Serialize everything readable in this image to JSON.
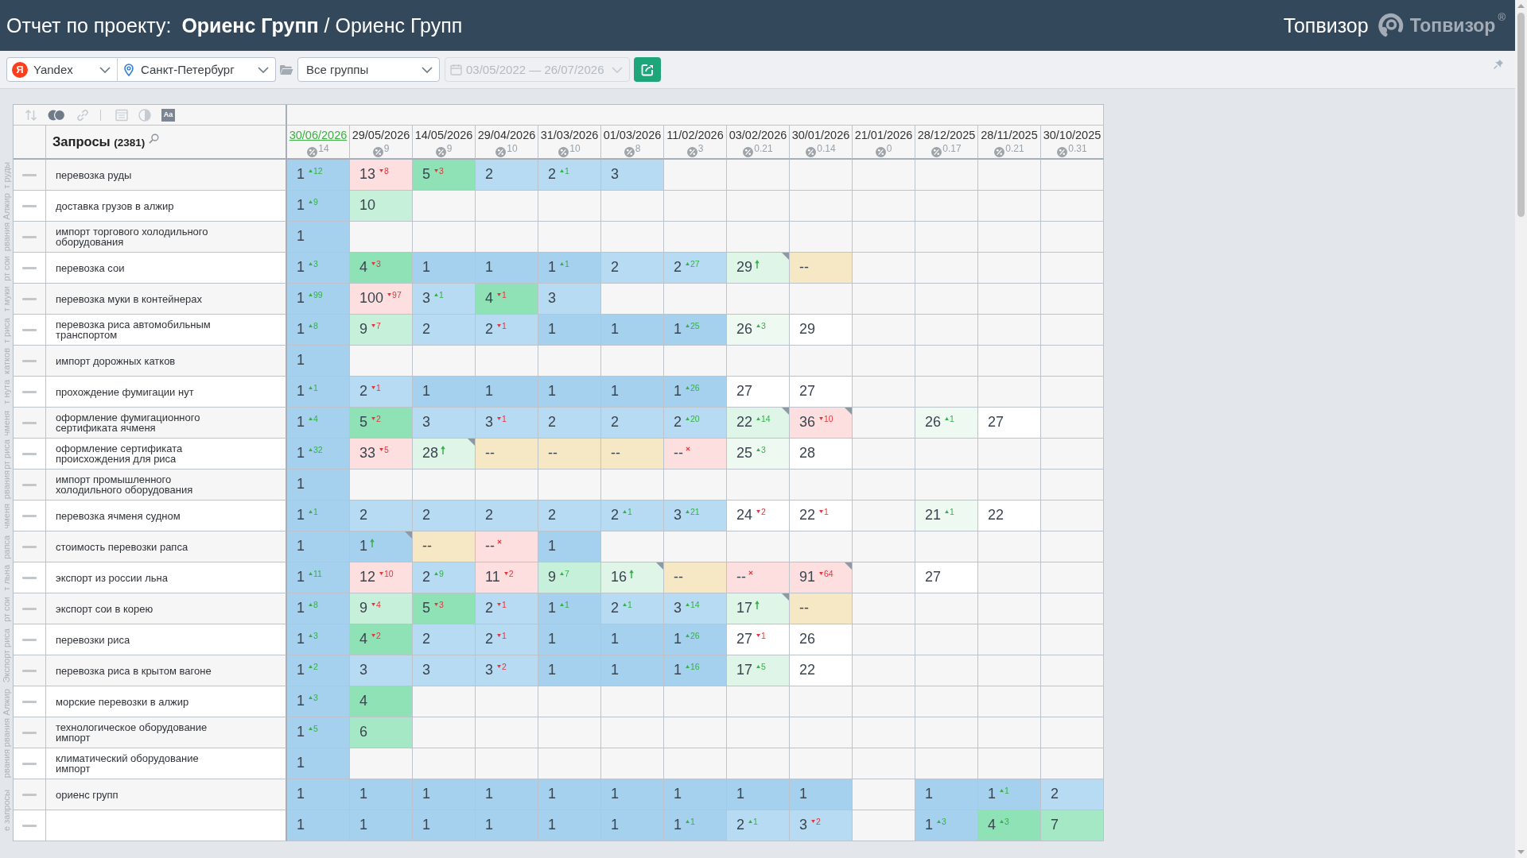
{
  "header": {
    "title": "Отчет по проекту: **Ориенс Групп** / Ориенс Групп",
    "account": "Топвизор",
    "brand": "Топвизор$^{®}$"
  },
  "filters": {
    "engine": {
      "logo": "Я",
      "value": "Yandex"
    },
    "region": {
      "value": "Санкт-Петербург"
    },
    "group": {
      "value": "Все группы"
    },
    "dates": {
      "value": "03/05/2022 — 26/07/2026",
      "disabled": true
    }
  },
  "table": {
    "tools": [
      {
        "kind": "sort",
        "disabled": true
      },
      {
        "kind": "toggle",
        "disabled": false
      },
      {
        "kind": "link",
        "disabled": true
      },
      {
        "kind": "divider"
      },
      {
        "kind": "panel",
        "disabled": true
      },
      {
        "kind": "contrast",
        "disabled": true
      },
      {
        "kind": "font",
        "label": "Aa",
        "disabled": false
      }
    ],
    "queries_title": "Запросы",
    "queries_count": "(2381)",
    "columns": [
      {
        "date": "30/06/2026",
        "selected": true,
        "share": "14"
      },
      {
        "date": "29/05/2026",
        "selected": false,
        "share": "9"
      },
      {
        "date": "14/05/2026",
        "selected": false,
        "share": "9"
      },
      {
        "date": "29/04/2026",
        "selected": false,
        "share": "10"
      },
      {
        "date": "31/03/2026",
        "selected": false,
        "share": "10"
      },
      {
        "date": "01/03/2026",
        "selected": false,
        "share": "8"
      },
      {
        "date": "11/02/2026",
        "selected": false,
        "share": "3"
      },
      {
        "date": "03/02/2026",
        "selected": false,
        "share": "0.21"
      },
      {
        "date": "30/01/2026",
        "selected": false,
        "share": "0.14"
      },
      {
        "date": "21/01/2026",
        "selected": false,
        "share": "0"
      },
      {
        "date": "28/12/2025",
        "selected": false,
        "share": "0.17"
      },
      {
        "date": "28/11/2025",
        "selected": false,
        "share": "0.21"
      },
      {
        "date": "30/10/2025",
        "selected": false,
        "share": "0.31"
      }
    ],
    "rows": [
      {
        "side_label": "т руды",
        "query": "перевозка руды",
        "cells": [
          {
            "value": "1",
            "kind": "up",
            "change": "12",
            "flag": false,
            "color": "#a5d1ef"
          },
          {
            "value": "13",
            "kind": "down",
            "change": "8",
            "flag": false,
            "color": "#fddfe0"
          },
          {
            "value": "5",
            "kind": "down",
            "change": "3",
            "flag": false,
            "color": "#8fe1b6"
          },
          {
            "value": "2",
            "kind": "plain",
            "flag": false,
            "color": "#b7dbf2"
          },
          {
            "value": "2",
            "kind": "up",
            "change": "1",
            "flag": false,
            "color": "#b7dbf2"
          },
          {
            "value": "3",
            "kind": "plain",
            "flag": false,
            "color": "#b7dbf2"
          },
          null,
          null,
          null,
          null,
          null,
          null,
          null
        ]
      },
      {
        "side_label": "Алжир",
        "query": "доставка грузов в алжир",
        "cells": [
          {
            "value": "1",
            "kind": "up",
            "change": "9",
            "flag": false,
            "color": "#a5d1ef"
          },
          {
            "value": "10",
            "kind": "plain",
            "flag": false,
            "color": "#c7f0da"
          },
          null,
          null,
          null,
          null,
          null,
          null,
          null,
          null,
          null,
          null,
          null
        ]
      },
      {
        "side_label": "рвания",
        "query": "импорт торгового холодильного оборудования",
        "cells": [
          {
            "value": "1",
            "kind": "plain",
            "flag": false,
            "color": "#a5d1ef"
          },
          null,
          null,
          null,
          null,
          null,
          null,
          null,
          null,
          null,
          null,
          null,
          null
        ]
      },
      {
        "side_label": "рт сои",
        "query": "перевозка сои",
        "cells": [
          {
            "value": "1",
            "kind": "up",
            "change": "3",
            "flag": false,
            "color": "#a5d1ef"
          },
          {
            "value": "4",
            "kind": "down",
            "change": "3",
            "flag": false,
            "color": "#8fe1b6"
          },
          {
            "value": "1",
            "kind": "plain",
            "flag": false,
            "color": "#a5d1ef"
          },
          {
            "value": "1",
            "kind": "plain",
            "flag": false,
            "color": "#a5d1ef"
          },
          {
            "value": "1",
            "kind": "up",
            "change": "1",
            "flag": false,
            "color": "#a5d1ef"
          },
          {
            "value": "2",
            "kind": "plain",
            "flag": false,
            "color": "#b7dbf2"
          },
          {
            "value": "2",
            "kind": "up",
            "change": "27",
            "flag": false,
            "color": "#b7dbf2"
          },
          {
            "value": "29",
            "kind": "new",
            "flag": true,
            "color": "#dff5e8"
          },
          {
            "value": "--",
            "kind": "plain",
            "flag": false,
            "color": "#f6e8c5"
          },
          null,
          null,
          null,
          null
        ]
      },
      {
        "side_label": "т муки",
        "query": "перевозка муки в контейнерах",
        "cells": [
          {
            "value": "1",
            "kind": "up",
            "change": "99",
            "flag": false,
            "color": "#a5d1ef"
          },
          {
            "value": "100",
            "kind": "down",
            "change": "97",
            "flag": false,
            "color": "#fddfe0"
          },
          {
            "value": "3",
            "kind": "up",
            "change": "1",
            "flag": false,
            "color": "#b7dbf2"
          },
          {
            "value": "4",
            "kind": "down",
            "change": "1",
            "flag": false,
            "color": "#8fe1b6"
          },
          {
            "value": "3",
            "kind": "plain",
            "flag": false,
            "color": "#b7dbf2"
          },
          null,
          null,
          null,
          null,
          null,
          null,
          null,
          null
        ]
      },
      {
        "side_label": "т риса",
        "query": "перевозка риса автомобильным транспортом",
        "cells": [
          {
            "value": "1",
            "kind": "up",
            "change": "8",
            "flag": false,
            "color": "#a5d1ef"
          },
          {
            "value": "9",
            "kind": "down",
            "change": "7",
            "flag": false,
            "color": "#c7f0da"
          },
          {
            "value": "2",
            "kind": "plain",
            "flag": false,
            "color": "#b7dbf2"
          },
          {
            "value": "2",
            "kind": "down",
            "change": "1",
            "flag": false,
            "color": "#b7dbf2"
          },
          {
            "value": "1",
            "kind": "plain",
            "flag": false,
            "color": "#a5d1ef"
          },
          {
            "value": "1",
            "kind": "plain",
            "flag": false,
            "color": "#a5d1ef"
          },
          {
            "value": "1",
            "kind": "up",
            "change": "25",
            "flag": false,
            "color": "#a5d1ef"
          },
          {
            "value": "26",
            "kind": "up",
            "change": "3",
            "flag": false,
            "color": "#edf9f1"
          },
          {
            "value": "29",
            "kind": "plain",
            "flag": false,
            "color": "#ffffff"
          },
          null,
          null,
          null,
          null
        ]
      },
      {
        "side_label": "катков",
        "query": "импорт дорожных катков",
        "cells": [
          {
            "value": "1",
            "kind": "plain",
            "flag": false,
            "color": "#a5d1ef"
          },
          null,
          null,
          null,
          null,
          null,
          null,
          null,
          null,
          null,
          null,
          null,
          null
        ]
      },
      {
        "side_label": "т нута",
        "query": "прохождение фумигации нут",
        "cells": [
          {
            "value": "1",
            "kind": "up",
            "change": "1",
            "flag": false,
            "color": "#a5d1ef"
          },
          {
            "value": "2",
            "kind": "down",
            "change": "1",
            "flag": false,
            "color": "#b7dbf2"
          },
          {
            "value": "1",
            "kind": "plain",
            "flag": false,
            "color": "#a5d1ef"
          },
          {
            "value": "1",
            "kind": "plain",
            "flag": false,
            "color": "#a5d1ef"
          },
          {
            "value": "1",
            "kind": "plain",
            "flag": false,
            "color": "#a5d1ef"
          },
          {
            "value": "1",
            "kind": "plain",
            "flag": false,
            "color": "#a5d1ef"
          },
          {
            "value": "1",
            "kind": "up",
            "change": "26",
            "flag": false,
            "color": "#a5d1ef"
          },
          {
            "value": "27",
            "kind": "plain",
            "flag": false,
            "color": "#ffffff"
          },
          {
            "value": "27",
            "kind": "plain",
            "flag": false,
            "color": "#ffffff"
          },
          null,
          null,
          null,
          null
        ]
      },
      {
        "side_label": "чменя",
        "query": "оформление фумигационного сертификата ячменя",
        "cells": [
          {
            "value": "1",
            "kind": "up",
            "change": "4",
            "flag": false,
            "color": "#a5d1ef"
          },
          {
            "value": "5",
            "kind": "down",
            "change": "2",
            "flag": false,
            "color": "#8fe1b6"
          },
          {
            "value": "3",
            "kind": "plain",
            "flag": false,
            "color": "#b7dbf2"
          },
          {
            "value": "3",
            "kind": "down",
            "change": "1",
            "flag": false,
            "color": "#b7dbf2"
          },
          {
            "value": "2",
            "kind": "plain",
            "flag": false,
            "color": "#b7dbf2"
          },
          {
            "value": "2",
            "kind": "plain",
            "flag": false,
            "color": "#b7dbf2"
          },
          {
            "value": "2",
            "kind": "up",
            "change": "20",
            "flag": false,
            "color": "#b7dbf2"
          },
          {
            "value": "22",
            "kind": "up",
            "change": "14",
            "flag": true,
            "color": "#dff5e8"
          },
          {
            "value": "36",
            "kind": "down",
            "change": "10",
            "flag": true,
            "color": "#fddfe0"
          },
          null,
          {
            "value": "26",
            "kind": "up",
            "change": "1",
            "flag": false,
            "color": "#edf9f1"
          },
          {
            "value": "27",
            "kind": "plain",
            "flag": false,
            "color": "#ffffff"
          },
          null
        ]
      },
      {
        "side_label": "рт риса",
        "query": "оформление сертификата происхождения для риса",
        "cells": [
          {
            "value": "1",
            "kind": "up",
            "change": "32",
            "flag": false,
            "color": "#a5d1ef"
          },
          {
            "value": "33",
            "kind": "down",
            "change": "5",
            "flag": false,
            "color": "#fddfe0"
          },
          {
            "value": "28",
            "kind": "new",
            "flag": true,
            "color": "#dff5e8"
          },
          {
            "value": "--",
            "kind": "plain",
            "flag": false,
            "color": "#f6e8c5"
          },
          {
            "value": "--",
            "kind": "plain",
            "flag": false,
            "color": "#f6e8c5"
          },
          {
            "value": "--",
            "kind": "plain",
            "flag": false,
            "color": "#f6e8c5"
          },
          {
            "value": "--",
            "kind": "lost",
            "flag": false,
            "color": "#fddfe0"
          },
          {
            "value": "25",
            "kind": "up",
            "change": "3",
            "flag": false,
            "color": "#edf9f1"
          },
          {
            "value": "28",
            "kind": "plain",
            "flag": false,
            "color": "#ffffff"
          },
          null,
          null,
          null,
          null
        ]
      },
      {
        "side_label": "рвания",
        "query": "импорт промышленного холодильного оборудования",
        "cells": [
          {
            "value": "1",
            "kind": "plain",
            "flag": false,
            "color": "#a5d1ef"
          },
          null,
          null,
          null,
          null,
          null,
          null,
          null,
          null,
          null,
          null,
          null,
          null
        ]
      },
      {
        "side_label": "чменя",
        "query": "перевозка ячменя судном",
        "cells": [
          {
            "value": "1",
            "kind": "up",
            "change": "1",
            "flag": false,
            "color": "#a5d1ef"
          },
          {
            "value": "2",
            "kind": "plain",
            "flag": false,
            "color": "#b7dbf2"
          },
          {
            "value": "2",
            "kind": "plain",
            "flag": false,
            "color": "#b7dbf2"
          },
          {
            "value": "2",
            "kind": "plain",
            "flag": false,
            "color": "#b7dbf2"
          },
          {
            "value": "2",
            "kind": "plain",
            "flag": false,
            "color": "#b7dbf2"
          },
          {
            "value": "2",
            "kind": "up",
            "change": "1",
            "flag": false,
            "color": "#b7dbf2"
          },
          {
            "value": "3",
            "kind": "up",
            "change": "21",
            "flag": false,
            "color": "#b7dbf2"
          },
          {
            "value": "24",
            "kind": "down",
            "change": "2",
            "flag": false,
            "color": "#ffffff"
          },
          {
            "value": "22",
            "kind": "down",
            "change": "1",
            "flag": false,
            "color": "#ffffff"
          },
          null,
          {
            "value": "21",
            "kind": "up",
            "change": "1",
            "flag": false,
            "color": "#edf9f1"
          },
          {
            "value": "22",
            "kind": "plain",
            "flag": false,
            "color": "#ffffff"
          },
          null
        ]
      },
      {
        "side_label": "рапса",
        "query": "стоимость перевозки рапса",
        "cells": [
          {
            "value": "1",
            "kind": "plain",
            "flag": false,
            "color": "#a5d1ef"
          },
          {
            "value": "1",
            "kind": "new",
            "flag": true,
            "color": "#a5d1ef"
          },
          {
            "value": "--",
            "kind": "plain",
            "flag": false,
            "color": "#f6e8c5"
          },
          {
            "value": "--",
            "kind": "lost",
            "flag": false,
            "color": "#fddfe0"
          },
          {
            "value": "1",
            "kind": "plain",
            "flag": false,
            "color": "#a5d1ef"
          },
          null,
          null,
          null,
          null,
          null,
          null,
          null,
          null
        ]
      },
      {
        "side_label": "т льна",
        "query": "экспорт из россии льна",
        "cells": [
          {
            "value": "1",
            "kind": "up",
            "change": "11",
            "flag": false,
            "color": "#a5d1ef"
          },
          {
            "value": "12",
            "kind": "down",
            "change": "10",
            "flag": false,
            "color": "#fddfe0"
          },
          {
            "value": "2",
            "kind": "up",
            "change": "9",
            "flag": false,
            "color": "#b7dbf2"
          },
          {
            "value": "11",
            "kind": "down",
            "change": "2",
            "flag": false,
            "color": "#fddfe0"
          },
          {
            "value": "9",
            "kind": "up",
            "change": "7",
            "flag": false,
            "color": "#c7f0da"
          },
          {
            "value": "16",
            "kind": "new",
            "flag": true,
            "color": "#dff5e8"
          },
          {
            "value": "--",
            "kind": "plain",
            "flag": false,
            "color": "#f6e8c5"
          },
          {
            "value": "--",
            "kind": "lost",
            "flag": false,
            "color": "#fddfe0"
          },
          {
            "value": "91",
            "kind": "down",
            "change": "64",
            "flag": true,
            "color": "#fddfe0"
          },
          null,
          {
            "value": "27",
            "kind": "plain",
            "flag": false,
            "color": "#ffffff"
          },
          null,
          null
        ]
      },
      {
        "side_label": "рт сои",
        "query": "экспорт сои в корею",
        "cells": [
          {
            "value": "1",
            "kind": "up",
            "change": "8",
            "flag": false,
            "color": "#a5d1ef"
          },
          {
            "value": "9",
            "kind": "down",
            "change": "4",
            "flag": false,
            "color": "#c7f0da"
          },
          {
            "value": "5",
            "kind": "down",
            "change": "3",
            "flag": false,
            "color": "#8fe1b6"
          },
          {
            "value": "2",
            "kind": "down",
            "change": "1",
            "flag": false,
            "color": "#b7dbf2"
          },
          {
            "value": "1",
            "kind": "up",
            "change": "1",
            "flag": false,
            "color": "#a5d1ef"
          },
          {
            "value": "2",
            "kind": "up",
            "change": "1",
            "flag": false,
            "color": "#b7dbf2"
          },
          {
            "value": "3",
            "kind": "up",
            "change": "14",
            "flag": false,
            "color": "#b7dbf2"
          },
          {
            "value": "17",
            "kind": "new",
            "flag": true,
            "color": "#dff5e8"
          },
          {
            "value": "--",
            "kind": "plain",
            "flag": false,
            "color": "#f6e8c5"
          },
          null,
          null,
          null,
          null
        ]
      },
      {
        "side_label": "Экспорт риса",
        "query": "перевозки риса",
        "cells": [
          {
            "value": "1",
            "kind": "up",
            "change": "3",
            "flag": false,
            "color": "#a5d1ef"
          },
          {
            "value": "4",
            "kind": "down",
            "change": "2",
            "flag": false,
            "color": "#8fe1b6"
          },
          {
            "value": "2",
            "kind": "plain",
            "flag": false,
            "color": "#b7dbf2"
          },
          {
            "value": "2",
            "kind": "down",
            "change": "1",
            "flag": false,
            "color": "#b7dbf2"
          },
          {
            "value": "1",
            "kind": "plain",
            "flag": false,
            "color": "#a5d1ef"
          },
          {
            "value": "1",
            "kind": "plain",
            "flag": false,
            "color": "#a5d1ef"
          },
          {
            "value": "1",
            "kind": "up",
            "change": "26",
            "flag": false,
            "color": "#a5d1ef"
          },
          {
            "value": "27",
            "kind": "down",
            "change": "1",
            "flag": false,
            "color": "#ffffff"
          },
          {
            "value": "26",
            "kind": "plain",
            "flag": false,
            "color": "#ffffff"
          },
          null,
          null,
          null,
          null
        ]
      },
      {
        "query": "перевозка риса в крытом вагоне",
        "cells": [
          {
            "value": "1",
            "kind": "up",
            "change": "2",
            "flag": false,
            "color": "#a5d1ef"
          },
          {
            "value": "3",
            "kind": "plain",
            "flag": false,
            "color": "#b7dbf2"
          },
          {
            "value": "3",
            "kind": "plain",
            "flag": false,
            "color": "#b7dbf2"
          },
          {
            "value": "3",
            "kind": "down",
            "change": "2",
            "flag": false,
            "color": "#b7dbf2"
          },
          {
            "value": "1",
            "kind": "plain",
            "flag": false,
            "color": "#a5d1ef"
          },
          {
            "value": "1",
            "kind": "plain",
            "flag": false,
            "color": "#a5d1ef"
          },
          {
            "value": "1",
            "kind": "up",
            "change": "16",
            "flag": false,
            "color": "#a5d1ef"
          },
          {
            "value": "17",
            "kind": "up",
            "change": "5",
            "flag": false,
            "color": "#dff5e8"
          },
          {
            "value": "22",
            "kind": "plain",
            "flag": false,
            "color": "#ffffff"
          },
          null,
          null,
          null,
          null
        ]
      },
      {
        "side_label": "Алжир",
        "query": "морские перевозки в алжир",
        "cells": [
          {
            "value": "1",
            "kind": "up",
            "change": "3",
            "flag": false,
            "color": "#a5d1ef"
          },
          {
            "value": "4",
            "kind": "plain",
            "flag": false,
            "color": "#8fe1b6"
          },
          null,
          null,
          null,
          null,
          null,
          null,
          null,
          null,
          null,
          null,
          null
        ]
      },
      {
        "side_label": "рвания",
        "query": "технологическое оборудование импорт",
        "cells": [
          {
            "value": "1",
            "kind": "up",
            "change": "5",
            "flag": false,
            "color": "#a5d1ef"
          },
          {
            "value": "6",
            "kind": "plain",
            "flag": false,
            "color": "#a5e8c5"
          },
          null,
          null,
          null,
          null,
          null,
          null,
          null,
          null,
          null,
          null,
          null
        ]
      },
      {
        "side_label": "рвания",
        "query": "климатический оборудование импорт",
        "cells": [
          {
            "value": "1",
            "kind": "plain",
            "flag": false,
            "color": "#a5d1ef"
          },
          null,
          null,
          null,
          null,
          null,
          null,
          null,
          null,
          null,
          null,
          null,
          null
        ]
      },
      {
        "side_label": "е запросы",
        "query": "ориенс групп",
        "cells": [
          {
            "value": "1",
            "kind": "plain",
            "flag": false,
            "color": "#a5d1ef"
          },
          {
            "value": "1",
            "kind": "plain",
            "flag": false,
            "color": "#a5d1ef"
          },
          {
            "value": "1",
            "kind": "plain",
            "flag": false,
            "color": "#a5d1ef"
          },
          {
            "value": "1",
            "kind": "plain",
            "flag": false,
            "color": "#a5d1ef"
          },
          {
            "value": "1",
            "kind": "plain",
            "flag": false,
            "color": "#a5d1ef"
          },
          {
            "value": "1",
            "kind": "plain",
            "flag": false,
            "color": "#a5d1ef"
          },
          {
            "value": "1",
            "kind": "plain",
            "flag": false,
            "color": "#a5d1ef"
          },
          {
            "value": "1",
            "kind": "plain",
            "flag": false,
            "color": "#a5d1ef"
          },
          {
            "value": "1",
            "kind": "plain",
            "flag": false,
            "color": "#a5d1ef"
          },
          null,
          {
            "value": "1",
            "kind": "plain",
            "flag": false,
            "color": "#a5d1ef"
          },
          {
            "value": "1",
            "kind": "up",
            "change": "1",
            "flag": false,
            "color": "#a5d1ef"
          },
          {
            "value": "2",
            "kind": "plain",
            "flag": false,
            "color": "#b7dbf2"
          }
        ]
      },
      {
        "cells": [
          {
            "value": "1",
            "kind": "plain",
            "flag": false,
            "color": "#a5d1ef"
          },
          {
            "value": "1",
            "kind": "plain",
            "flag": false,
            "color": "#a5d1ef"
          },
          {
            "value": "1",
            "kind": "plain",
            "flag": false,
            "color": "#a5d1ef"
          },
          {
            "value": "1",
            "kind": "plain",
            "flag": false,
            "color": "#a5d1ef"
          },
          {
            "value": "1",
            "kind": "plain",
            "flag": false,
            "color": "#a5d1ef"
          },
          {
            "value": "1",
            "kind": "plain",
            "flag": false,
            "color": "#a5d1ef"
          },
          {
            "value": "1",
            "kind": "up",
            "change": "1",
            "flag": false,
            "color": "#a5d1ef"
          },
          {
            "value": "2",
            "kind": "up",
            "change": "1",
            "flag": false,
            "color": "#b7dbf2"
          },
          {
            "value": "3",
            "kind": "down",
            "change": "2",
            "flag": false,
            "color": "#b7dbf2"
          },
          null,
          {
            "value": "1",
            "kind": "up",
            "change": "3",
            "flag": false,
            "color": "#a5d1ef"
          },
          {
            "value": "4",
            "kind": "up",
            "change": "3",
            "flag": false,
            "color": "#8fe1b6"
          },
          {
            "value": "7",
            "kind": "plain",
            "flag": false,
            "color": "#a5e8c5"
          }
        ]
      }
    ]
  }
}
